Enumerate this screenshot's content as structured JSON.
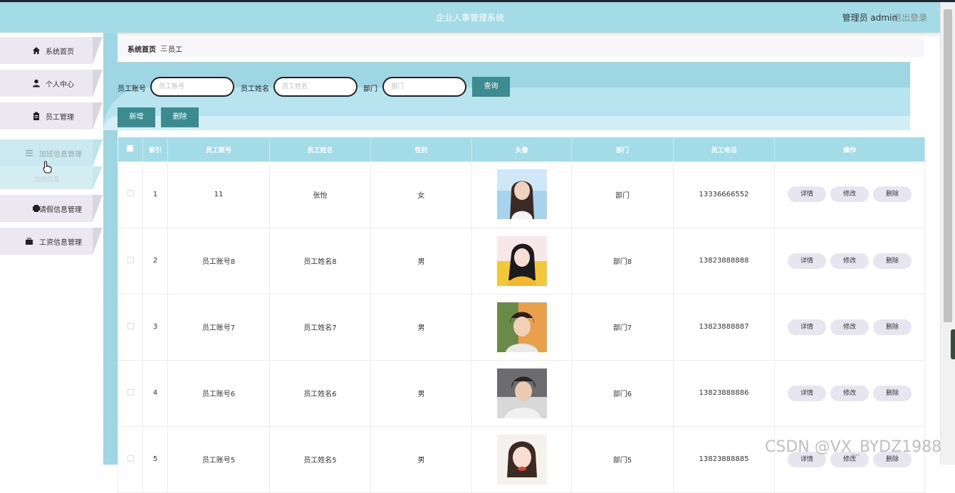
{
  "header": {
    "title": "企业人事管理系统",
    "user": "管理员 admin",
    "logout": "退出登录"
  },
  "sidebar": {
    "items": [
      {
        "label": "系统首页",
        "icon": "home-icon"
      },
      {
        "label": "个人中心",
        "icon": "user-icon"
      },
      {
        "label": "员工管理",
        "icon": "clipboard-icon"
      },
      {
        "label": "加班信息管理",
        "icon": "list-icon"
      },
      {
        "label": "请假信息管理",
        "icon": "printer-icon"
      },
      {
        "label": "工资信息管理",
        "icon": "briefcase-icon"
      }
    ],
    "sub_item": "加班信息"
  },
  "breadcrumb": {
    "home": "系统首页",
    "separator": "三",
    "current": "员工"
  },
  "search": {
    "account_label": "员工账号",
    "account_placeholder": "员工账号",
    "name_label": "员工姓名",
    "name_placeholder": "员工姓名",
    "dept_label": "部门",
    "dept_placeholder": "部门",
    "query_button": "查询"
  },
  "actions": {
    "add": "新增",
    "delete": "删除"
  },
  "table": {
    "headers": [
      "索引",
      "员工账号",
      "员工姓名",
      "性别",
      "头像",
      "部门",
      "员工电话",
      "操作"
    ],
    "op_labels": {
      "detail": "详情",
      "edit": "修改",
      "delete": "删除"
    },
    "rows": [
      {
        "index": "1",
        "account": "11",
        "name": "张怡",
        "gender": "女",
        "dept": "部门",
        "phone": "13336666552"
      },
      {
        "index": "2",
        "account": "员工账号8",
        "name": "员工姓名8",
        "gender": "男",
        "dept": "部门8",
        "phone": "13823888888"
      },
      {
        "index": "3",
        "account": "员工账号7",
        "name": "员工姓名7",
        "gender": "男",
        "dept": "部门7",
        "phone": "13823888887"
      },
      {
        "index": "4",
        "account": "员工账号6",
        "name": "员工姓名6",
        "gender": "男",
        "dept": "部门6",
        "phone": "13823888886"
      },
      {
        "index": "5",
        "account": "员工账号5",
        "name": "员工姓名5",
        "gender": "男",
        "dept": "部门5",
        "phone": "13823888885"
      }
    ]
  },
  "watermark": "CSDN @VX_BYDZ1988",
  "colors": {
    "header_bg": "#a3dbe6",
    "button_bg": "#3c8b91",
    "sidebar_item_bg": "#ebe8f1"
  }
}
